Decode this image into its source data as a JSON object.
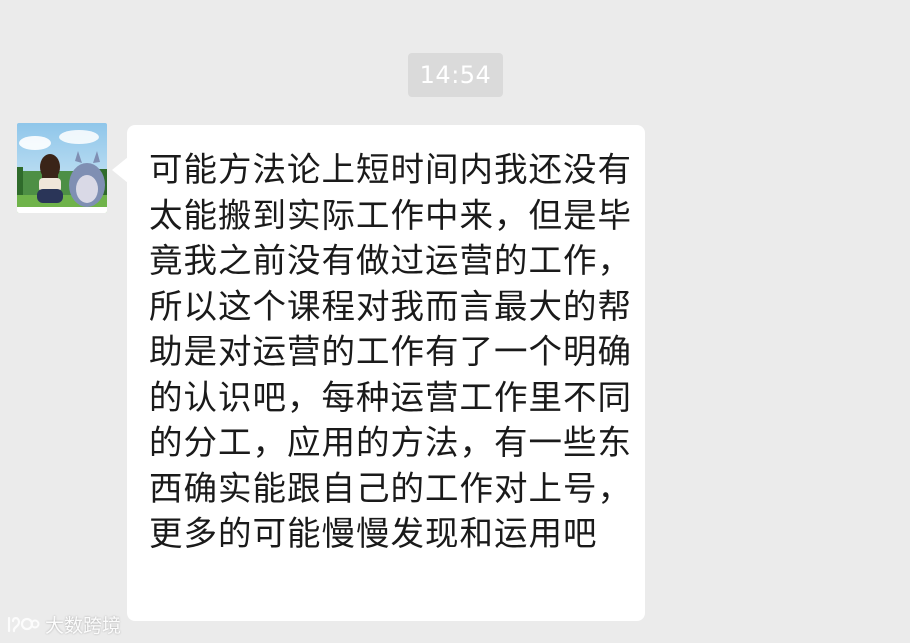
{
  "chat": {
    "timestamp": "14:54",
    "message": {
      "sender_avatar": "avatar",
      "text": "可能方法论上短时间内我还没有太能搬到实际工作中来，但是毕竟我之前没有做过运营的工作，所以这个课程对我而言最大的帮助是对运营的工作有了一个明确的认识吧，每种运营工作里不同的分工，应用的方法，有一些东西确实能跟自己的工作对上号，更多的可能慢慢发现和运用吧"
    }
  },
  "watermark": {
    "text": "大数跨境",
    "icon": "watermark-logo-icon"
  },
  "colors": {
    "background": "#ebebeb",
    "bubble": "#ffffff",
    "timestamp_bg": "#dadada",
    "timestamp_text": "#ffffff",
    "message_text": "#1a1a1a"
  }
}
